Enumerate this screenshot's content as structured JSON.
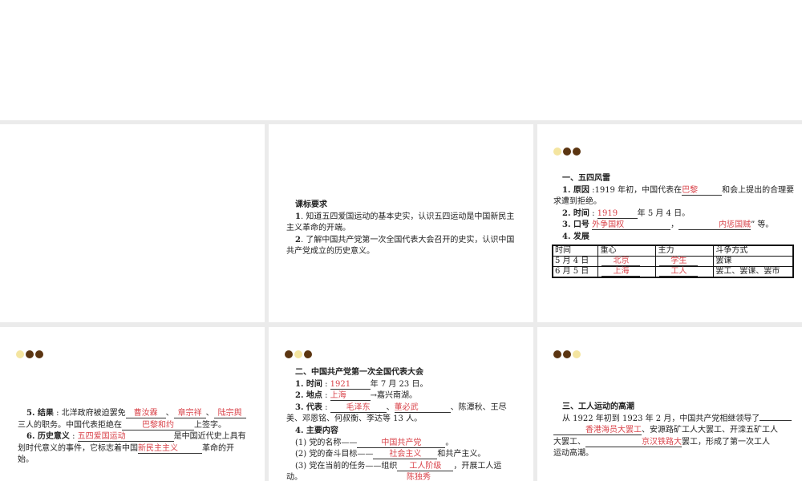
{
  "colors": {
    "dark": "#5b3511",
    "light": "#f4e5a0",
    "answer": "#d9434a"
  },
  "slides": [
    {
      "id": "slide-blank",
      "dots": null,
      "lines": []
    },
    {
      "id": "slide-requirements",
      "dots": null,
      "lines": [
        {
          "b": true,
          "ind": true,
          "segs": [
            {
              "t": "课标要求"
            }
          ]
        },
        {
          "ind": true,
          "segs": [
            {
              "t": "1",
              "b": true
            },
            {
              "t": ". 知道五四爱国运动的基本史实，认识五四运动是中国新民主"
            }
          ]
        },
        {
          "segs": [
            {
              "t": "主义革命的开端。"
            }
          ]
        },
        {
          "ind": true,
          "segs": [
            {
              "t": "2",
              "b": true
            },
            {
              "t": ". 了解中国共产党第一次全国代表大会召开的史实，认识中国"
            }
          ]
        },
        {
          "segs": [
            {
              "t": "共产党成立的历史意义。"
            }
          ]
        }
      ]
    },
    {
      "id": "slide-may-fourth",
      "dots": [
        "light",
        "dark",
        "dark"
      ],
      "lines": [
        {
          "b": true,
          "ind": true,
          "segs": [
            {
              "t": "一、五四风雷"
            }
          ]
        },
        {
          "ind": true,
          "segs": [
            {
              "t": "1. 原因",
              "b": true
            },
            {
              "t": " :1919 年初，中国代表在"
            },
            {
              "a": "巴黎",
              "w": 50,
              "al": "left"
            },
            {
              "t": "和会上提出的合理要"
            }
          ]
        },
        {
          "segs": [
            {
              "t": "求遭到拒绝。"
            }
          ]
        },
        {
          "ind": true,
          "segs": [
            {
              "t": "2. 时间",
              "b": true
            },
            {
              "t": " : "
            },
            {
              "a": "1919",
              "w": 50,
              "al": "left"
            },
            {
              "t": "年 5 月 4 日。"
            }
          ]
        },
        {
          "ind": true,
          "segs": [
            {
              "t": "3. 口号",
              "b": true
            },
            {
              "t": " "
            },
            {
              "a": "外争国权",
              "w": 98,
              "al": "left"
            },
            {
              "t": "，"
            },
            {
              "a": "内惩国贼",
              "w": 90,
              "al": "right"
            },
            {
              "t": "” 等。"
            }
          ]
        },
        {
          "ind": true,
          "segs": [
            {
              "t": "4. 发展",
              "b": true
            }
          ]
        }
      ],
      "table": {
        "headers": [
          "时间",
          "重心",
          "主力",
          "斗争方式"
        ],
        "rows": [
          [
            {
              "t": "5 月 4 日"
            },
            {
              "a": "北京"
            },
            {
              "a": "学生"
            },
            {
              "t": "罢课"
            }
          ],
          [
            {
              "t": "6 月 5 日"
            },
            {
              "a": "上海"
            },
            {
              "a": "工人"
            },
            {
              "t": "罢工、罢课、罢市"
            }
          ]
        ]
      }
    },
    {
      "id": "slide-results",
      "dots": [
        "light",
        "dark",
        "dark"
      ],
      "lines": [
        {
          "ind": true,
          "segs": [
            {
              "t": "5. 结果",
              "b": true
            },
            {
              "t": " : 北洋政府被迫罢免"
            },
            {
              "a": "曹汝霖",
              "w": 50
            },
            {
              "t": "、"
            },
            {
              "a": "章宗祥",
              "w": 40
            },
            {
              "t": "、"
            },
            {
              "a": "陆宗舆",
              "w": 40
            }
          ]
        },
        {
          "segs": [
            {
              "t": "三人的职务。中国代表拒绝在"
            },
            {
              "a": "巴黎和约",
              "w": 90
            },
            {
              "t": "上签字。"
            }
          ]
        },
        {
          "ind": true,
          "segs": [
            {
              "t": "6. 历史意义",
              "b": true
            },
            {
              "t": " : "
            },
            {
              "a": "五四爱国运动",
              "w": 120,
              "al": "left"
            },
            {
              "t": "是中国近代史上具有"
            }
          ]
        },
        {
          "segs": [
            {
              "t": "划时代意义的事件，它标志着中国"
            },
            {
              "a": "新民主主义",
              "w": 80,
              "al": "left"
            },
            {
              "t": "革命的开"
            }
          ]
        },
        {
          "segs": [
            {
              "t": "始。"
            }
          ]
        }
      ]
    },
    {
      "id": "slide-first-congress",
      "dots": [
        "dark",
        "light",
        "dark"
      ],
      "lines": [
        {
          "b": true,
          "ind": true,
          "segs": [
            {
              "t": "二、中国共产党第一次全国代表大会"
            }
          ]
        },
        {
          "ind": true,
          "segs": [
            {
              "t": "1. 时间",
              "b": true
            },
            {
              "t": " : "
            },
            {
              "a": "1921",
              "w": 50,
              "al": "left"
            },
            {
              "t": "年 7 月 23 日。"
            }
          ]
        },
        {
          "ind": true,
          "segs": [
            {
              "t": "2. 地点",
              "b": true
            },
            {
              "t": " : "
            },
            {
              "a": "上海",
              "w": 50,
              "al": "left"
            },
            {
              "t": "→嘉兴南湖。"
            }
          ]
        },
        {
          "ind": true,
          "segs": [
            {
              "t": "3. 代表",
              "b": true
            },
            {
              "t": " : "
            },
            {
              "a": "毛泽东",
              "w": 70
            },
            {
              "t": "、"
            },
            {
              "a": "董必武",
              "w": 70,
              "al": "left"
            },
            {
              "t": "、陈潭秋、王尽"
            }
          ]
        },
        {
          "segs": [
            {
              "t": "美、邓恩铭、何叔衡、李达等 13 人。"
            }
          ]
        },
        {
          "ind": true,
          "segs": [
            {
              "t": "4. 主要内容",
              "b": true
            }
          ]
        },
        {
          "ind": true,
          "segs": [
            {
              "t": "(1) 党的名称——"
            },
            {
              "a": "中国共产党",
              "w": 110
            },
            {
              "t": "。"
            }
          ]
        },
        {
          "ind": true,
          "segs": [
            {
              "t": "(2) 党的奋斗目标——"
            },
            {
              "a": "社会主义",
              "w": 80
            },
            {
              "t": "和共产主义。"
            }
          ]
        },
        {
          "ind": true,
          "segs": [
            {
              "t": "(3) 党在当前的任务——组织"
            },
            {
              "a": "工人阶级",
              "w": 70
            },
            {
              "t": "，开展工人运"
            }
          ]
        },
        {
          "segs": [
            {
              "t": "动。"
            },
            {
              "t": "陈独秀",
              "red": true,
              "pad": 130
            }
          ]
        }
      ]
    },
    {
      "id": "slide-labor-movement",
      "dots": [
        "dark",
        "dark",
        "light"
      ],
      "lines": [
        {
          "b": true,
          "ind": true,
          "segs": [
            {
              "t": "三、工人运动的高潮"
            }
          ]
        },
        {
          "ind": true,
          "segs": [
            {
              "t": "从 1922 年初到 1923 年 2 月，中国共产党相继领导了"
            },
            {
              "a": "",
              "w": 40
            }
          ]
        },
        {
          "segs": [
            {
              "a": "香港海员大罢工",
              "w": 110,
              "al": "right"
            },
            {
              "t": "、安源路矿工人大罢工、开滦五矿工人"
            }
          ]
        },
        {
          "segs": [
            {
              "t": "大罢工、"
            },
            {
              "a": "京汉铁路大",
              "w": 120,
              "al": "right"
            },
            {
              "t": "罢工，形成了第一次工人"
            }
          ]
        },
        {
          "segs": [
            {
              "t": "运动高潮。"
            }
          ]
        }
      ]
    }
  ]
}
